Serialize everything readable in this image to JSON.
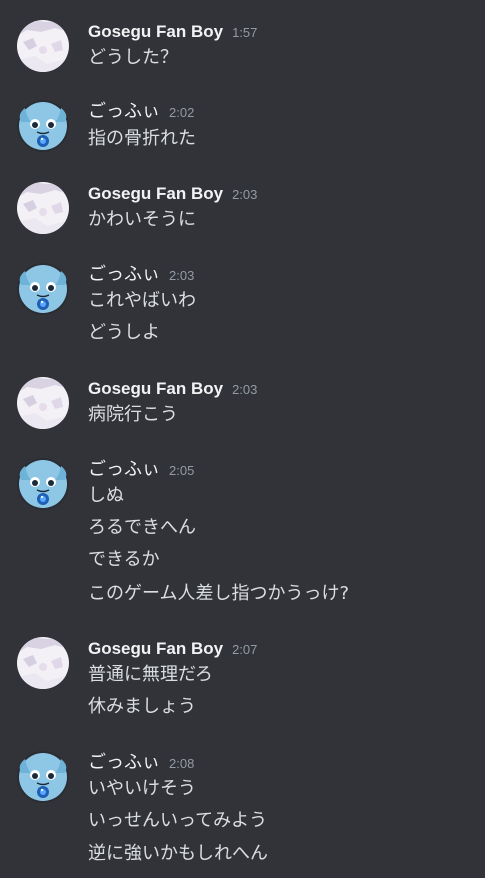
{
  "messages": [
    {
      "username": "Gosegu Fan Boy",
      "time": "1:57",
      "avatar": "gosegu-avatar-icon",
      "lines": [
        "どうした？"
      ]
    },
    {
      "username": "ごっふぃ",
      "time": "2:02",
      "avatar": "gofi-avatar-icon",
      "lines": [
        "指の骨折れた"
      ]
    },
    {
      "username": "Gosegu Fan Boy",
      "time": "2:03",
      "avatar": "gosegu-avatar-icon",
      "lines": [
        "かわいそうに"
      ]
    },
    {
      "username": "ごっふぃ",
      "time": "2:03",
      "avatar": "gofi-avatar-icon",
      "lines": [
        "これやばいわ",
        "どうしよ"
      ]
    },
    {
      "username": "Gosegu Fan Boy",
      "time": "2:03",
      "avatar": "gosegu-avatar-icon",
      "lines": [
        "病院行こう"
      ]
    },
    {
      "username": "ごっふぃ",
      "time": "2:05",
      "avatar": "gofi-avatar-icon",
      "lines": [
        "しぬ",
        "ろるできへん",
        "できるか",
        "このゲーム人差し指つかうっけ?"
      ]
    },
    {
      "username": "Gosegu Fan Boy",
      "time": "2:07",
      "avatar": "gosegu-avatar-icon",
      "lines": [
        "普通に無理だろ",
        "休みましょう"
      ]
    },
    {
      "username": "ごっふぃ",
      "time": "2:08",
      "avatar": "gofi-avatar-icon",
      "lines": [
        "いやいけそう",
        "いっせんいってみよう",
        "逆に強いかもしれへん"
      ]
    }
  ],
  "colors": {
    "background": "#313338",
    "username": "#f2f3f5",
    "timestamp": "#949ba4",
    "message_text": "#dbdee1"
  }
}
